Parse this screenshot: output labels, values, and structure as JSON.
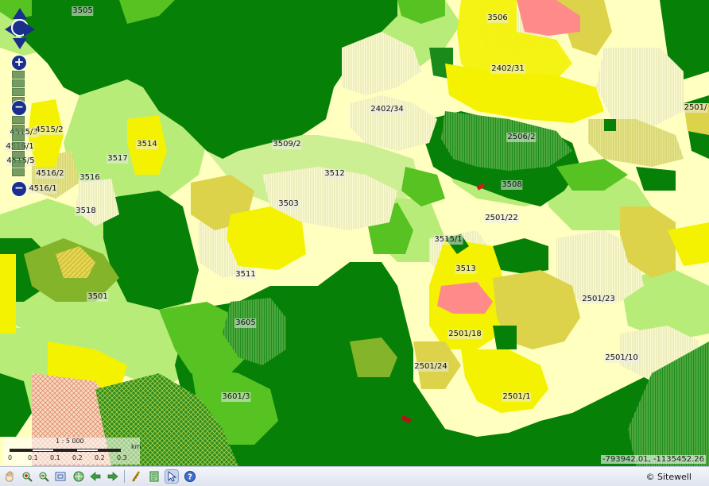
{
  "map": {
    "colors": {
      "dark_green": "#068006",
      "green": "#57c322",
      "light_green": "#b7ec79",
      "pale_green": "#def5a5",
      "cream": "#ffffc0",
      "yellow": "#f4f200",
      "olive_yellow": "#dcd34b",
      "pink": "#ff8a8a",
      "olive": "#84b42a"
    },
    "parcels": [
      {
        "id": "p-3505",
        "label": "3505"
      },
      {
        "id": "p-3506",
        "label": "3506"
      },
      {
        "id": "p-2402-31",
        "label": "2402/31"
      },
      {
        "id": "p-2501-edge",
        "label": "2501/"
      },
      {
        "id": "p-2402-34",
        "label": "2402/34"
      },
      {
        "id": "p-2506-2",
        "label": "2506/2"
      },
      {
        "id": "p-4515-3",
        "label": "4515/3"
      },
      {
        "id": "p-4515-2",
        "label": "4515/2"
      },
      {
        "id": "p-4516-1a",
        "label": "4516/1"
      },
      {
        "id": "p-4515-5",
        "label": "4515/5"
      },
      {
        "id": "p-4516-2",
        "label": "4516/2"
      },
      {
        "id": "p-4516-1b",
        "label": "4516/1"
      },
      {
        "id": "p-3514",
        "label": "3514"
      },
      {
        "id": "p-3517",
        "label": "3517"
      },
      {
        "id": "p-3509-2",
        "label": "3509/2"
      },
      {
        "id": "p-3512",
        "label": "3512"
      },
      {
        "id": "p-3508",
        "label": "3508"
      },
      {
        "id": "p-3516",
        "label": "3516"
      },
      {
        "id": "p-3503",
        "label": "3503"
      },
      {
        "id": "p-2501-22",
        "label": "2501/22"
      },
      {
        "id": "p-3518",
        "label": "3518"
      },
      {
        "id": "p-3515-1",
        "label": "3515/1"
      },
      {
        "id": "p-3513",
        "label": "3513"
      },
      {
        "id": "p-3511",
        "label": "3511"
      },
      {
        "id": "p-3501",
        "label": "3501"
      },
      {
        "id": "p-2501-23",
        "label": "2501/23"
      },
      {
        "id": "p-3605",
        "label": "3605"
      },
      {
        "id": "p-2501-18",
        "label": "2501/18"
      },
      {
        "id": "p-2501-10",
        "label": "2501/10"
      },
      {
        "id": "p-2501-24",
        "label": "2501/24"
      },
      {
        "id": "p-3601-3",
        "label": "3601/3"
      },
      {
        "id": "p-2501-1",
        "label": "2501/1"
      }
    ]
  },
  "scale": {
    "ratio": "1 : 5 000",
    "unit": "km",
    "ticks": [
      "0",
      "0.1",
      "0.1",
      "0.2",
      "0.2",
      "0.3"
    ]
  },
  "coordinates": "-793942.01, -1135452.26",
  "toolbar": {
    "tools": [
      "pan-hand-icon",
      "zoom-in-icon",
      "zoom-out-icon",
      "zoom-box-icon",
      "full-extent-icon",
      "previous-view-icon",
      "next-view-icon",
      "measure-icon",
      "print-icon",
      "select-arrow-icon",
      "help-icon"
    ],
    "copyright": "© Sitewell"
  }
}
